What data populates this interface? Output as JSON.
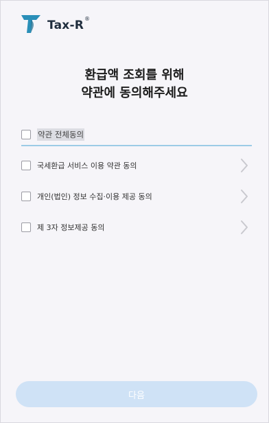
{
  "header": {
    "brand": "Tax-R",
    "brand_mark": "®",
    "logo_icon": "tax-r-logo-icon"
  },
  "title": {
    "line1": "환급액 조회를 위해",
    "line2": "약관에 동의해주세요"
  },
  "agree_all": {
    "label": "약관 전체동의",
    "checked": false
  },
  "terms": [
    {
      "label": "국세환급 서비스 이용 약관 동의",
      "checked": false,
      "icon": "chevron-right-icon"
    },
    {
      "label": "개인(법인) 정보 수집·이용 제공 동의",
      "checked": false,
      "icon": "chevron-right-icon"
    },
    {
      "label": "제 3자 정보제공 동의",
      "checked": false,
      "icon": "chevron-right-icon"
    }
  ],
  "next_button": {
    "label": "다음",
    "enabled": false
  },
  "colors": {
    "accent_line": "#9ccbe6",
    "button_disabled": "#cfe2f6",
    "logo": "#2a8fb8"
  }
}
